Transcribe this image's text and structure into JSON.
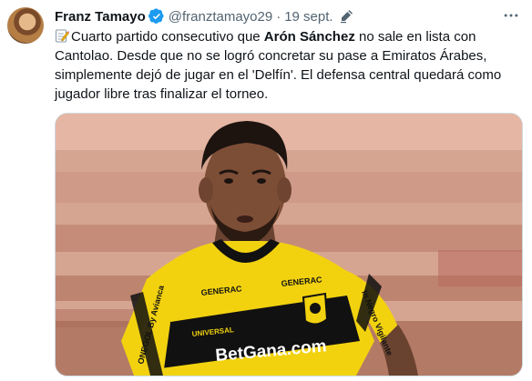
{
  "tweet": {
    "author_name": "Franz Tamayo",
    "handle": "@franztamayo29",
    "separator": "·",
    "date": "19 sept.",
    "text_parts": [
      "Cuarto partido consecutivo que ",
      "Arón Sánchez",
      " no sale en lista con Cantolao. Desde que no se logró concretar su pase a Emiratos Árabes, simplemente dejó de jugar en el 'Delfín'. El defensa central quedará como jugador libre tras finalizar el torneo."
    ],
    "media": {
      "kit_sponsor_left": "GENERAC",
      "kit_sponsor_right": "GENERAC",
      "kit_brand": "UNIVERSAL",
      "kit_main_sponsor": "BetGana.com",
      "kit_side_left": "ONEGOL By Avianca",
      "kit_side_right": "In Negro Vigilante"
    }
  },
  "icons": {
    "verified": "verified-badge-icon",
    "edit": "edited-pencil-icon",
    "more": "more-dots-icon",
    "memo": "memo-emoji-icon"
  },
  "colors": {
    "verified_blue": "#1d9bf0",
    "secondary_text": "#536471"
  }
}
